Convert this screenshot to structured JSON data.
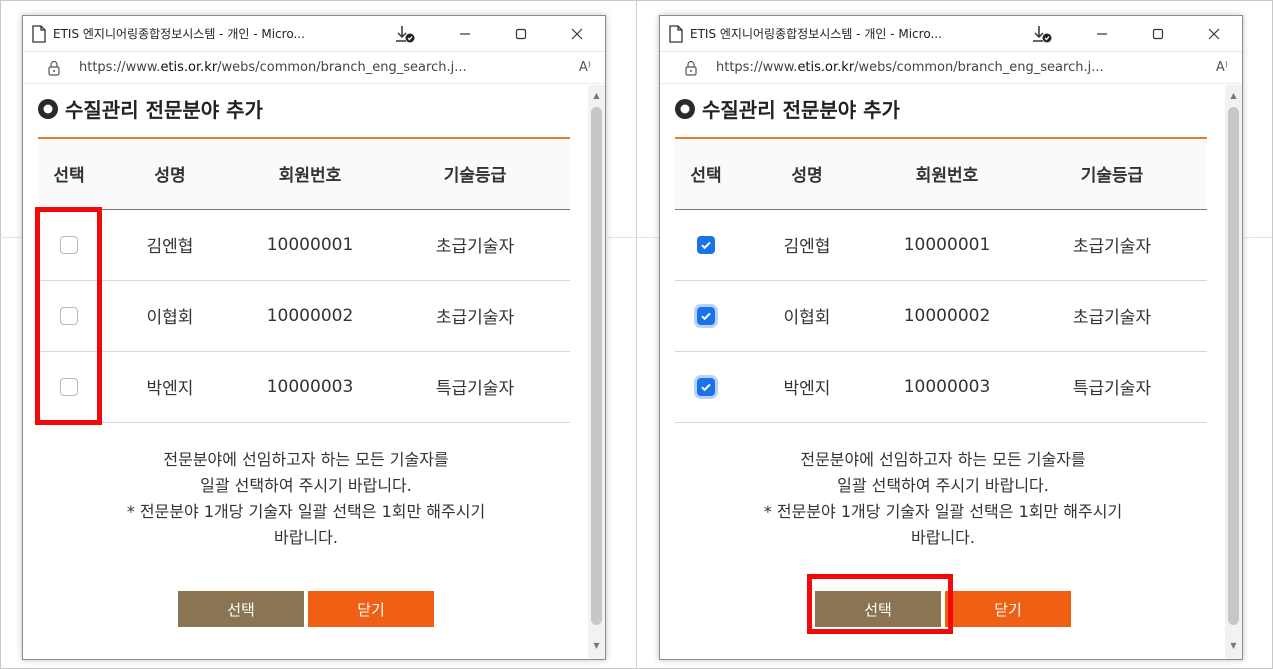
{
  "windows": [
    {
      "title": "ETIS 엔지니어링종합정보시스템 - 개인 - Micro...",
      "url_prefix": "https://www.",
      "url_host": "etis.or.kr",
      "url_path": "/webs/common/branch_eng_search.j...",
      "reader_label": "A⁾",
      "heading": "수질관리 전문분야 추가",
      "columns": [
        "선택",
        "성명",
        "회원번호",
        "기술등급"
      ],
      "rows": [
        {
          "checked": false,
          "name": "김엔협",
          "member_no": "10000001",
          "grade": "초급기술자"
        },
        {
          "checked": false,
          "name": "이협회",
          "member_no": "10000002",
          "grade": "초급기술자"
        },
        {
          "checked": false,
          "name": "박엔지",
          "member_no": "10000003",
          "grade": "특급기술자"
        }
      ],
      "notice_lines": [
        "전문분야에 선임하고자 하는 모든 기술자를",
        "일괄 선택하여 주시기 바랍니다.",
        "* 전문분야 1개당 기술자 일괄 선택은 1회만 해주시기",
        "바랍니다."
      ],
      "select_label": "선택",
      "close_label": "닫기"
    },
    {
      "title": "ETIS 엔지니어링종합정보시스템 - 개인 - Micro...",
      "url_prefix": "https://www.",
      "url_host": "etis.or.kr",
      "url_path": "/webs/common/branch_eng_search.j...",
      "reader_label": "A⁾",
      "heading": "수질관리 전문분야 추가",
      "columns": [
        "선택",
        "성명",
        "회원번호",
        "기술등급"
      ],
      "rows": [
        {
          "checked": true,
          "name": "김엔협",
          "member_no": "10000001",
          "grade": "초급기술자"
        },
        {
          "checked": true,
          "name": "이협회",
          "member_no": "10000002",
          "grade": "초급기술자"
        },
        {
          "checked": true,
          "name": "박엔지",
          "member_no": "10000003",
          "grade": "특급기술자"
        }
      ],
      "notice_lines": [
        "전문분야에 선임하고자 하는 모든 기술자를",
        "일괄 선택하여 주시기 바랍니다.",
        "* 전문분야 1개당 기술자 일괄 선택은 1회만 해주시기",
        "바랍니다."
      ],
      "select_label": "선택",
      "close_label": "닫기"
    }
  ],
  "colors": {
    "accent_rule": "#e87b2c",
    "select_button": "#8a7451",
    "close_button": "#f06014",
    "checkbox_checked": "#1a73e8",
    "highlight_box": "#f20a0a"
  },
  "icons": [
    "document-icon",
    "download-icon",
    "minimize-icon",
    "maximize-icon",
    "close-icon",
    "lock-icon",
    "read-aloud-icon",
    "bullet-circle-icon",
    "checkmark-icon"
  ]
}
